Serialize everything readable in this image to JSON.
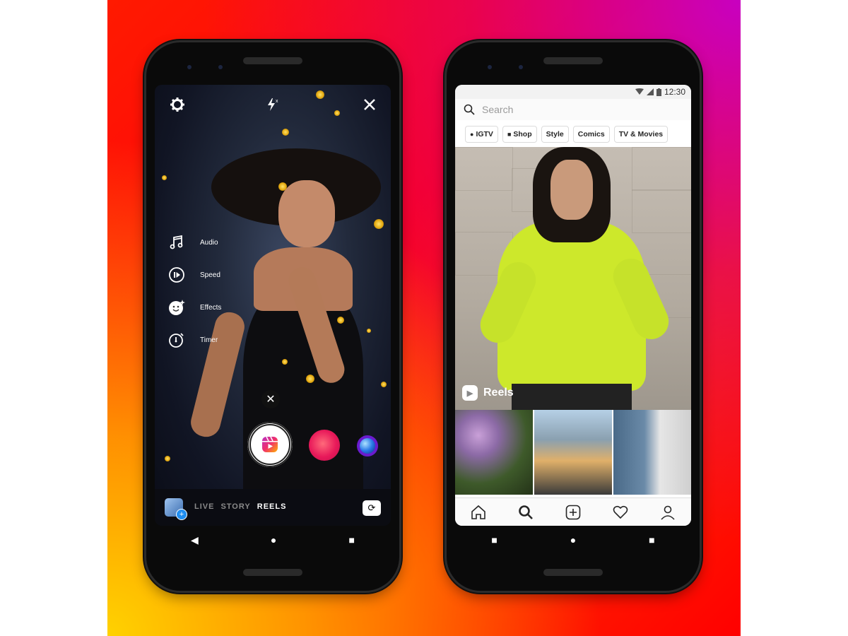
{
  "left_phone": {
    "top_bar": {
      "settings_icon": "gear-icon",
      "flash_icon": "flash-off-icon",
      "close_icon": "close-icon"
    },
    "tools": [
      {
        "icon": "music-note-icon",
        "label": "Audio"
      },
      {
        "icon": "speed-icon",
        "label": "Speed"
      },
      {
        "icon": "effects-face-icon",
        "label": "Effects"
      },
      {
        "icon": "timer-icon",
        "label": "Timer"
      }
    ],
    "dismiss_glyph": "✕",
    "modes": [
      {
        "label": "LIVE",
        "active": false
      },
      {
        "label": "STORY",
        "active": false
      },
      {
        "label": "REELS",
        "active": true
      }
    ],
    "gallery_plus": "+",
    "flip_glyph": "⟳"
  },
  "right_phone": {
    "status": {
      "time": "12:30"
    },
    "search": {
      "placeholder": "Search"
    },
    "chips": [
      {
        "icon": "igtv-icon",
        "label": "IGTV"
      },
      {
        "icon": "shop-bag-icon",
        "label": "Shop"
      },
      {
        "icon": "",
        "label": "Style"
      },
      {
        "icon": "",
        "label": "Comics"
      },
      {
        "icon": "",
        "label": "TV & Movies"
      }
    ],
    "hero_label": "Reels",
    "tabs": [
      "home",
      "search",
      "add",
      "activity",
      "profile"
    ]
  },
  "system_nav": {
    "back": "◀",
    "home": "●",
    "recents": "■"
  },
  "colors": {
    "reels_pink": "#e8195a",
    "chip_border": "#dbdbdb",
    "shirt": "#cde82b"
  }
}
